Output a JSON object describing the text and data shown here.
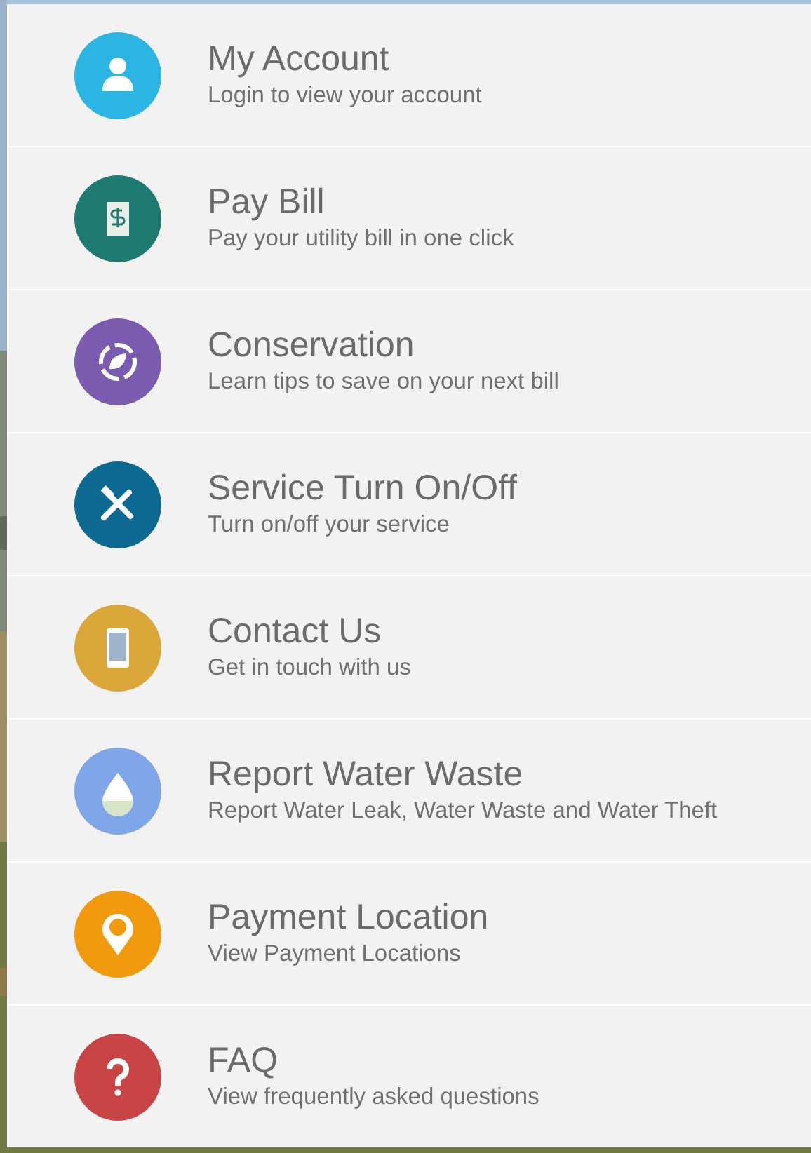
{
  "menu": [
    {
      "title": "My Account",
      "subtitle": "Login to view your account",
      "kind": "person",
      "color": "#2bb5e3"
    },
    {
      "title": "Pay Bill",
      "subtitle": "Pay your utility bill in one click",
      "kind": "bill",
      "color": "#1f7a72"
    },
    {
      "title": "Conservation",
      "subtitle": "Learn tips to save on your next bill",
      "kind": "leaf",
      "color": "#7b5bb0"
    },
    {
      "title": "Service Turn On/Off",
      "subtitle": "Turn on/off your service",
      "kind": "tools",
      "color": "#0e6a92"
    },
    {
      "title": "Contact Us",
      "subtitle": "Get in touch with us",
      "kind": "phone",
      "color": "#dba73a"
    },
    {
      "title": "Report Water Waste",
      "subtitle": "Report Water Leak, Water Waste and Water Theft",
      "kind": "drop",
      "color": "#7ea6e8"
    },
    {
      "title": "Payment Location",
      "subtitle": "View Payment Locations",
      "kind": "pin",
      "color": "#f19a0e"
    },
    {
      "title": "FAQ",
      "subtitle": "View frequently asked questions",
      "kind": "question",
      "color": "#c94545"
    }
  ]
}
